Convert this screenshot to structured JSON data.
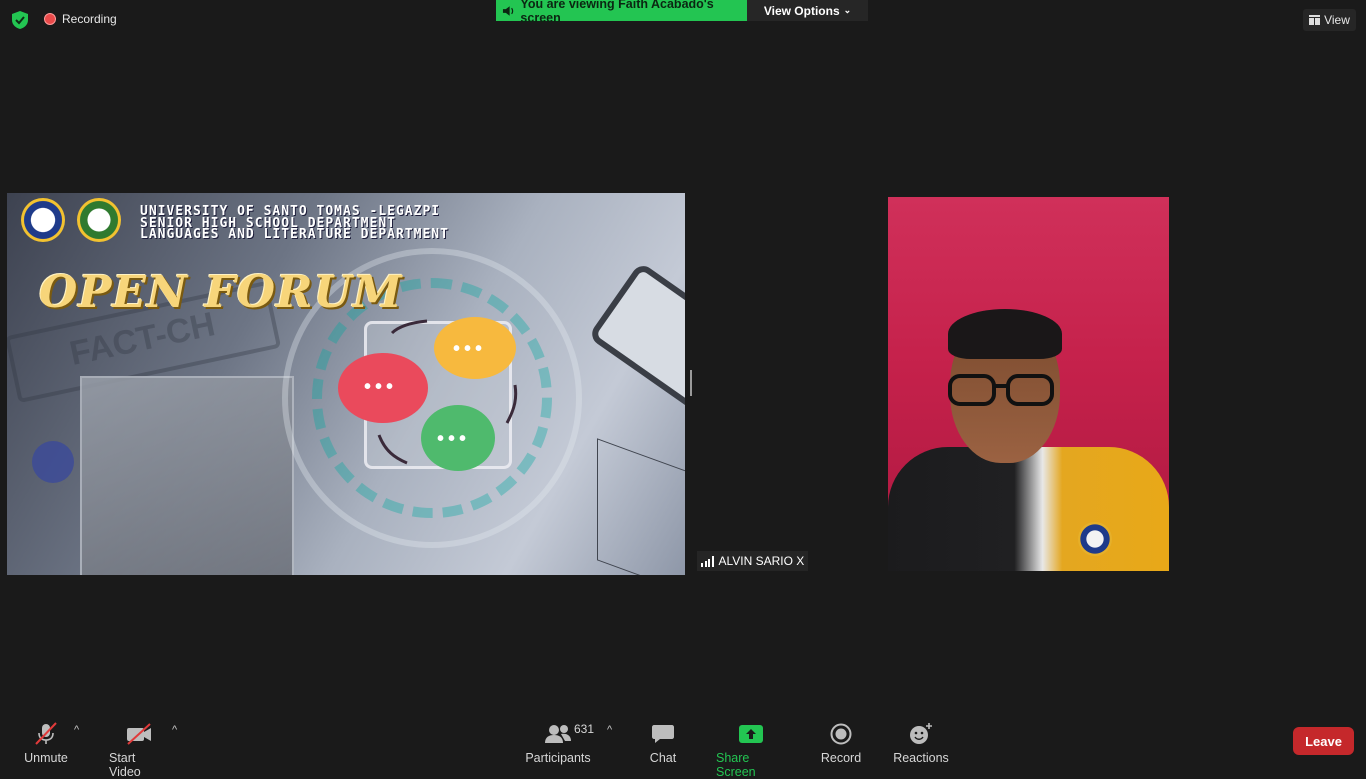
{
  "topbar": {
    "recording_label": "Recording",
    "viewing_banner": "You are viewing Faith Acabado's screen",
    "view_options_label": "View Options",
    "view_label": "View"
  },
  "shared_screen": {
    "header_lines": [
      "UNIVERSITY OF SANTO TOMAS -LEGAZPI",
      "SENIOR HIGH SCHOOL DEPARTMENT",
      "LANGUAGES AND LITERATURE DEPARTMENT"
    ],
    "title": "OPEN FORUM",
    "stamp_text": "FACT-CH"
  },
  "participant": {
    "name": "ALVIN SARIO X"
  },
  "toolbar": {
    "unmute_label": "Unmute",
    "start_video_label": "Start Video",
    "participants_label": "Participants",
    "participants_count": "631",
    "chat_label": "Chat",
    "share_screen_label": "Share Screen",
    "record_label": "Record",
    "reactions_label": "Reactions",
    "leave_label": "Leave"
  },
  "colors": {
    "background": "#1a1a1a",
    "banner_green": "#23c552",
    "leave_red": "#c5282b",
    "video_bg": "#c5214b"
  }
}
